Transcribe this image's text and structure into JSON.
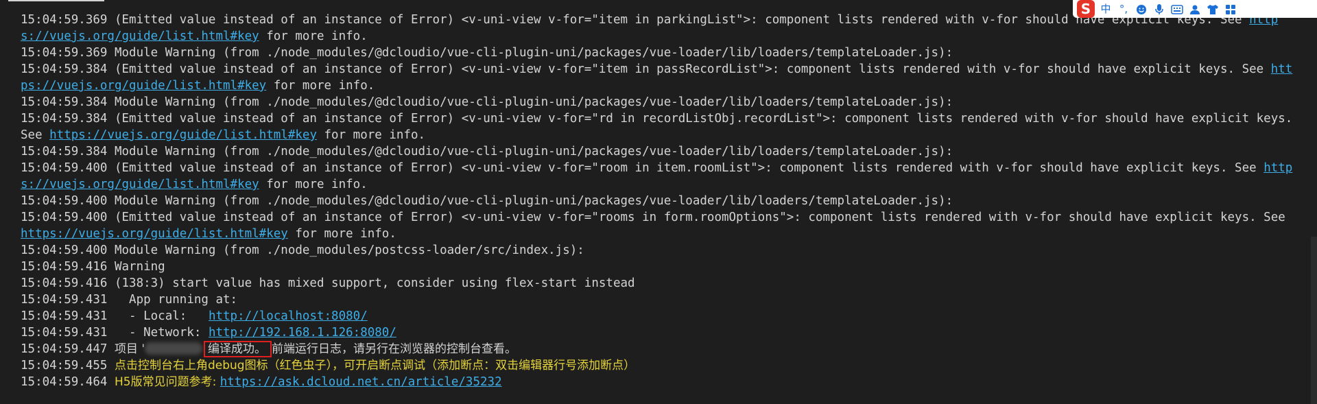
{
  "ime": {
    "logo": "S",
    "mode": "中",
    "punct": "°,",
    "icons": [
      "emoji-icon",
      "microphone-icon",
      "keyboard-icon",
      "user-icon",
      "shirt-icon",
      "grid-icon"
    ]
  },
  "lines": [
    {
      "segs": [
        {
          "t": "15:04:59.369 (Emitted value instead of an instance of Error) <v-uni-view v-for=\"item in parkingList\">: component lists rendered with v-for should have explicit keys. See "
        },
        {
          "t": "https://vuejs.org/guide/list.html#key",
          "link": true
        },
        {
          "t": " for more info."
        }
      ]
    },
    {
      "segs": [
        {
          "t": "15:04:59.369 Module Warning (from ./node_modules/@dcloudio/vue-cli-plugin-uni/packages/vue-loader/lib/loaders/templateLoader.js):"
        }
      ]
    },
    {
      "segs": [
        {
          "t": "15:04:59.384 (Emitted value instead of an instance of Error) <v-uni-view v-for=\"item in passRecordList\">: component lists rendered with v-for should have explicit keys. See "
        },
        {
          "t": "https://vuejs.org/guide/list.html#key",
          "link": true
        },
        {
          "t": " for more info."
        }
      ]
    },
    {
      "segs": [
        {
          "t": "15:04:59.384 Module Warning (from ./node_modules/@dcloudio/vue-cli-plugin-uni/packages/vue-loader/lib/loaders/templateLoader.js):"
        }
      ]
    },
    {
      "segs": [
        {
          "t": "15:04:59.384 (Emitted value instead of an instance of Error) <v-uni-view v-for=\"rd in recordListObj.recordList\">: component lists rendered with v-for should have explicit keys. See "
        },
        {
          "t": "https://vuejs.org/guide/list.html#key",
          "link": true
        },
        {
          "t": " for more info."
        }
      ]
    },
    {
      "segs": [
        {
          "t": "15:04:59.384 Module Warning (from ./node_modules/@dcloudio/vue-cli-plugin-uni/packages/vue-loader/lib/loaders/templateLoader.js):"
        }
      ]
    },
    {
      "segs": [
        {
          "t": "15:04:59.400 (Emitted value instead of an instance of Error) <v-uni-view v-for=\"room in item.roomList\">: component lists rendered with v-for should have explicit keys. See "
        },
        {
          "t": "https://vuejs.org/guide/list.html#key",
          "link": true
        },
        {
          "t": " for more info."
        }
      ]
    },
    {
      "segs": [
        {
          "t": "15:04:59.400 Module Warning (from ./node_modules/@dcloudio/vue-cli-plugin-uni/packages/vue-loader/lib/loaders/templateLoader.js):"
        }
      ]
    },
    {
      "segs": [
        {
          "t": "15:04:59.400 (Emitted value instead of an instance of Error) <v-uni-view v-for=\"rooms in form.roomOptions\">: component lists rendered with v-for should have explicit keys. See "
        },
        {
          "t": "https://vuejs.org/guide/list.html#key",
          "link": true
        },
        {
          "t": " for more info."
        }
      ]
    },
    {
      "segs": [
        {
          "t": "15:04:59.400 Module Warning (from ./node_modules/postcss-loader/src/index.js):"
        }
      ]
    },
    {
      "segs": [
        {
          "t": "15:04:59.416 Warning"
        }
      ]
    },
    {
      "segs": [
        {
          "t": "15:04:59.416 (138:3) start value has mixed support, consider using flex-start instead"
        }
      ]
    },
    {
      "segs": [
        {
          "t": "15:04:59.431   App running at:"
        }
      ]
    },
    {
      "segs": [
        {
          "t": "15:04:59.431   - Local:   "
        },
        {
          "t": "http://localhost:8080/",
          "link": true
        }
      ]
    },
    {
      "segs": [
        {
          "t": "15:04:59.431   - Network: "
        },
        {
          "t": "http://192.168.1.126:8080/",
          "link": true
        }
      ]
    },
    {
      "segs": [
        {
          "t": "15:04:59.447 "
        },
        {
          "t": "项目 '",
          "zh": true
        },
        {
          "blur": true
        },
        {
          "t": "编译成功。",
          "zh": true,
          "box": true
        },
        {
          "t": "前端运行日志，请另行在浏览器的控制台查看。",
          "zh": true
        }
      ]
    },
    {
      "segs": [
        {
          "t": "15:04:59.455 "
        },
        {
          "t": "点击控制台右上角debug图标（红色虫子），可开启断点调试（添加断点：双击编辑器行号添加断点）",
          "zh": true,
          "yellow": true
        }
      ]
    },
    {
      "segs": [
        {
          "t": "15:04:59.464 "
        },
        {
          "t": "H5版常见问题参考: ",
          "zh": true,
          "yellow": true
        },
        {
          "t": "https://ask.dcloud.net.cn/article/35232",
          "link": true
        }
      ]
    }
  ]
}
